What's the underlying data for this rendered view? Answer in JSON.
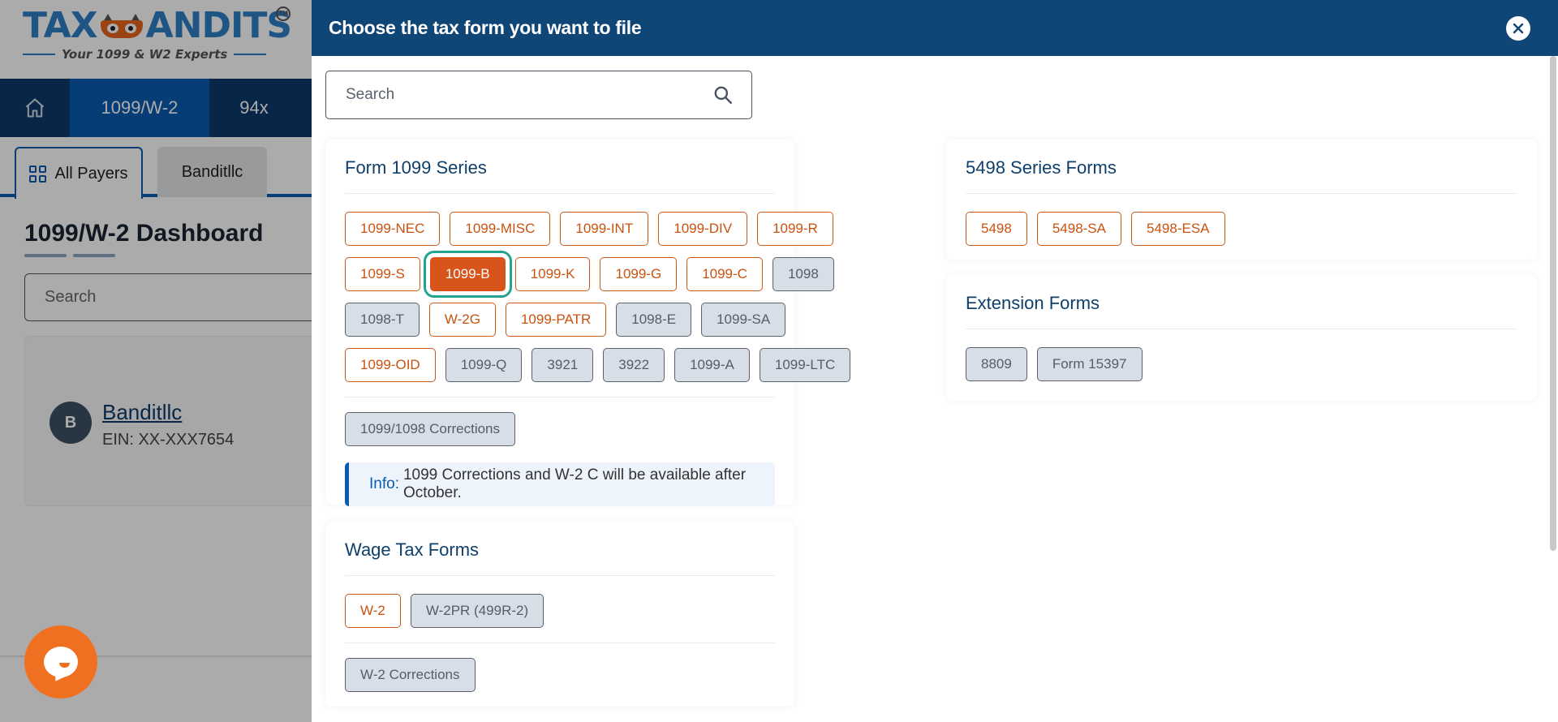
{
  "colors": {
    "brand_blue": "#0f4675",
    "nav_active": "#0a5cb0",
    "accent_orange": "#d9541a",
    "selected_outline": "#21a38e",
    "disabled_gray": "#d7dee8"
  },
  "background_app": {
    "logo": {
      "text_left": "TAX",
      "text_right": "ANDITS",
      "trademark": "TM",
      "tagline": "Your 1099 & W2 Experts"
    },
    "topnav": {
      "home_icon": "home-icon",
      "items": [
        {
          "label": "1099/W-2",
          "active": true
        },
        {
          "label": "94x",
          "active": false
        }
      ]
    },
    "subtabs": [
      {
        "label": "All Payers",
        "icon": "grid-icon",
        "active": true
      },
      {
        "label": "Banditllc",
        "active": false
      }
    ],
    "dashboard_title": "1099/W-2 Dashboard",
    "search_placeholder": "Search",
    "payer": {
      "avatar_initial": "B",
      "name": "Banditllc",
      "ein": "EIN: XX-XXX7654"
    },
    "chat_icon": "chat-icon"
  },
  "modal": {
    "title": "Choose the tax form you want to file",
    "close_icon": "close-icon",
    "search": {
      "placeholder": "Search",
      "value": "",
      "icon": "search-icon"
    },
    "sections": {
      "form_1099": {
        "title": "Form 1099 Series",
        "rows": [
          [
            {
              "label": "1099-NEC",
              "state": "enabled"
            },
            {
              "label": "1099-MISC",
              "state": "enabled"
            },
            {
              "label": "1099-INT",
              "state": "enabled"
            },
            {
              "label": "1099-DIV",
              "state": "enabled"
            },
            {
              "label": "1099-R",
              "state": "enabled"
            }
          ],
          [
            {
              "label": "1099-S",
              "state": "enabled"
            },
            {
              "label": "1099-B",
              "state": "selected"
            },
            {
              "label": "1099-K",
              "state": "enabled"
            },
            {
              "label": "1099-G",
              "state": "enabled"
            },
            {
              "label": "1099-C",
              "state": "enabled"
            },
            {
              "label": "1098",
              "state": "disabled"
            }
          ],
          [
            {
              "label": "1098-T",
              "state": "disabled"
            },
            {
              "label": "W-2G",
              "state": "enabled"
            },
            {
              "label": "1099-PATR",
              "state": "enabled"
            },
            {
              "label": "1098-E",
              "state": "disabled"
            },
            {
              "label": "1099-SA",
              "state": "disabled"
            }
          ],
          [
            {
              "label": "1099-OID",
              "state": "enabled"
            },
            {
              "label": "1099-Q",
              "state": "disabled"
            },
            {
              "label": "3921",
              "state": "disabled"
            },
            {
              "label": "3922",
              "state": "disabled"
            },
            {
              "label": "1099-A",
              "state": "disabled"
            },
            {
              "label": "1099-LTC",
              "state": "disabled"
            }
          ]
        ],
        "corrections": {
          "label": "1099/1098 Corrections",
          "state": "disabled"
        },
        "info": {
          "label": "Info:",
          "text": "1099 Corrections and W-2 C will be available after October."
        }
      },
      "wage": {
        "title": "Wage Tax Forms",
        "forms": [
          {
            "label": "W-2",
            "state": "enabled"
          },
          {
            "label": "W-2PR (499R-2)",
            "state": "disabled"
          }
        ],
        "corrections": {
          "label": "W-2 Corrections",
          "state": "disabled"
        }
      },
      "form_5498": {
        "title": "5498 Series Forms",
        "forms": [
          {
            "label": "5498",
            "state": "enabled"
          },
          {
            "label": "5498-SA",
            "state": "enabled"
          },
          {
            "label": "5498-ESA",
            "state": "enabled"
          }
        ]
      },
      "extension": {
        "title": "Extension Forms",
        "forms": [
          {
            "label": "8809",
            "state": "disabled"
          },
          {
            "label": "Form 15397",
            "state": "disabled"
          }
        ]
      }
    }
  }
}
